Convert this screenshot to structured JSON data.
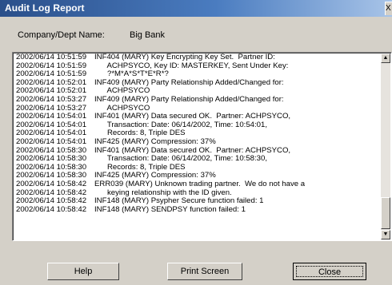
{
  "window": {
    "title": "Audit Log Report",
    "close_glyph": "X"
  },
  "company": {
    "label": "Company/Dept Name:",
    "value": "Big Bank"
  },
  "log": {
    "lines": [
      {
        "ts": "2002/06/14 10:51:59",
        "text": "INF404 (MARY) Key Encrypting Key Set.  Partner ID:"
      },
      {
        "ts": "2002/06/14 10:51:59",
        "text": "      ACHPSYCO, Key ID: MASTERKEY, Sent Under Key:"
      },
      {
        "ts": "2002/06/14 10:51:59",
        "text": "      ?*M*A*S*T*E*R*?"
      },
      {
        "ts": "2002/06/14 10:52:01",
        "text": "INF409 (MARY) Party Relationship Added/Changed for:"
      },
      {
        "ts": "2002/06/14 10:52:01",
        "text": "      ACHPSYCO"
      },
      {
        "ts": "2002/06/14 10:53:27",
        "text": "INF409 (MARY) Party Relationship Added/Changed for:"
      },
      {
        "ts": "2002/06/14 10:53:27",
        "text": "      ACHPSYCO"
      },
      {
        "ts": "2002/06/14 10:54:01",
        "text": "INF401 (MARY) Data secured OK.  Partner: ACHPSYCO,"
      },
      {
        "ts": "2002/06/14 10:54:01",
        "text": "      Transaction: Date: 06/14/2002, Time: 10:54:01,"
      },
      {
        "ts": "2002/06/14 10:54:01",
        "text": "      Records: 8, Triple DES"
      },
      {
        "ts": "2002/06/14 10:54:01",
        "text": "INF425 (MARY) Compression: 37%"
      },
      {
        "ts": "2002/06/14 10:58:30",
        "text": "INF401 (MARY) Data secured OK.  Partner: ACHPSYCO,"
      },
      {
        "ts": "2002/06/14 10:58:30",
        "text": "      Transaction: Date: 06/14/2002, Time: 10:58:30,"
      },
      {
        "ts": "2002/06/14 10:58:30",
        "text": "      Records: 8, Triple DES"
      },
      {
        "ts": "2002/06/14 10:58:30",
        "text": "INF425 (MARY) Compression: 37%"
      },
      {
        "ts": "2002/06/14 10:58:42",
        "text": "ERR039 (MARY) Unknown trading partner.  We do not have a"
      },
      {
        "ts": "2002/06/14 10:58:42",
        "text": "      keying relationship with the ID given."
      },
      {
        "ts": "2002/06/14 10:58:42",
        "text": "INF148 (MARY) Psypher Secure function failed: 1"
      },
      {
        "ts": "2002/06/14 10:58:42",
        "text": "INF148 (MARY) SENDPSY function failed: 1"
      }
    ]
  },
  "scrollbar": {
    "up_glyph": "▲",
    "down_glyph": "▼"
  },
  "buttons": {
    "help": "Help",
    "print": "Print Screen",
    "close": "Close"
  }
}
